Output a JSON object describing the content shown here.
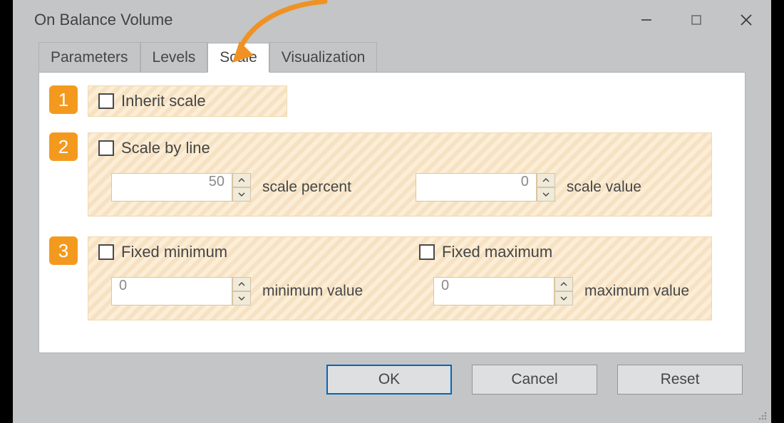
{
  "window": {
    "title": "On Balance Volume"
  },
  "tabs": {
    "items": [
      {
        "label": "Parameters",
        "active": false
      },
      {
        "label": "Levels",
        "active": false
      },
      {
        "label": "Scale",
        "active": true
      },
      {
        "label": "Visualization",
        "active": false
      }
    ]
  },
  "annotations": {
    "badge1": "1",
    "badge2": "2",
    "badge3": "3"
  },
  "section1": {
    "inherit_label": "Inherit scale",
    "inherit_checked": false
  },
  "section2": {
    "scalebyline_label": "Scale by line",
    "scalebyline_checked": false,
    "scale_percent_value": "50",
    "scale_percent_label": "scale percent",
    "scale_value_value": "0",
    "scale_value_label": "scale value"
  },
  "section3": {
    "fixed_min_label": "Fixed minimum",
    "fixed_min_checked": false,
    "fixed_max_label": "Fixed maximum",
    "fixed_max_checked": false,
    "min_value": "0",
    "min_label": "minimum value",
    "max_value": "0",
    "max_label": "maximum value"
  },
  "buttons": {
    "ok": "OK",
    "cancel": "Cancel",
    "reset": "Reset"
  }
}
